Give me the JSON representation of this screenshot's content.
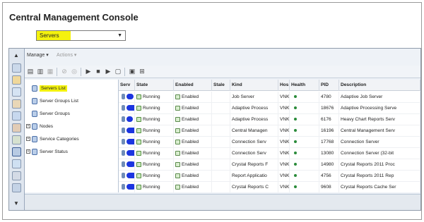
{
  "app": {
    "title": "Central Management Console"
  },
  "view_selector": {
    "value": "Servers"
  },
  "menu": {
    "manage": "Manage ▾",
    "actions": "Actions ▾"
  },
  "tree": {
    "items": [
      {
        "label": "Servers List"
      },
      {
        "label": "Server Groups List"
      },
      {
        "label": "Server Groups"
      },
      {
        "label": "Nodes"
      },
      {
        "label": "Service Categories"
      },
      {
        "label": "Server Status"
      }
    ]
  },
  "table": {
    "headers": [
      "Serv",
      "State",
      "Enabled",
      "Stale",
      "Kind",
      "Hos",
      "Health",
      "PID",
      "Description"
    ],
    "rows": [
      {
        "state": "Running",
        "enabled": "Enabled",
        "kind": "Job Server",
        "host": "VNK",
        "pid": "4780",
        "desc": "Adaptive Job Server"
      },
      {
        "state": "Running",
        "enabled": "Enabled",
        "kind": "Adaptive Process",
        "host": "VNK",
        "pid": "18676",
        "desc": "Adaptive Processing Serve"
      },
      {
        "state": "Running",
        "enabled": "Enabled",
        "kind": "Adaptive Process",
        "host": "VNK",
        "pid": "6176",
        "desc": "Heavy Chart Reports Serv"
      },
      {
        "state": "Running",
        "enabled": "Enabled",
        "kind": "Central Managen",
        "host": "VNK",
        "pid": "16196",
        "desc": "Central Management Serv"
      },
      {
        "state": "Running",
        "enabled": "Enabled",
        "kind": "Connection Serv",
        "host": "VNK",
        "pid": "17768",
        "desc": "Connection Server"
      },
      {
        "state": "Running",
        "enabled": "Enabled",
        "kind": "Connection Serv",
        "host": "VNK",
        "pid": "13080",
        "desc": "Connection Server (32-bit"
      },
      {
        "state": "Running",
        "enabled": "Enabled",
        "kind": "Crystal Reports F",
        "host": "VNK",
        "pid": "14980",
        "desc": "Crystal Reports 2011 Proc"
      },
      {
        "state": "Running",
        "enabled": "Enabled",
        "kind": "Report Applicatio",
        "host": "VNK",
        "pid": "4756",
        "desc": "Crystal Reports 2011 Rep"
      },
      {
        "state": "Running",
        "enabled": "Enabled",
        "kind": "Crystal Reports C",
        "host": "VNK",
        "pid": "9608",
        "desc": "Crystal Reports Cache Ser"
      }
    ]
  }
}
